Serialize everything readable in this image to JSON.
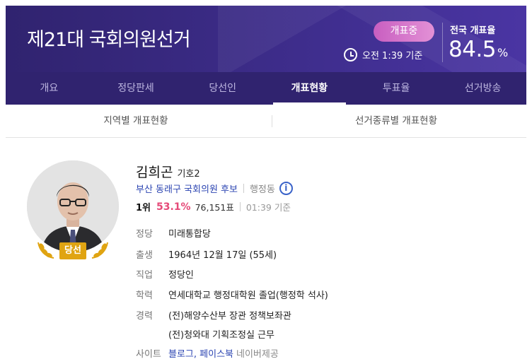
{
  "header": {
    "title": "제21대 국회의원선거",
    "status_badge": "개표중",
    "time_text": "오전 1:39 기준",
    "rate_label": "전국 개표율",
    "rate_value": "84.5",
    "rate_unit": "%"
  },
  "nav": {
    "items": [
      "개요",
      "정당판세",
      "당선인",
      "개표현황",
      "투표율",
      "선거방송"
    ],
    "active": "개표현황"
  },
  "subtabs": [
    "지역별 개표현황",
    "선거종류별 개표현황"
  ],
  "candidate": {
    "name": "김희곤",
    "number": "기호2",
    "district": "부산 동래구 국회의원 후보",
    "dong": "행정동",
    "rank": "1위",
    "percent": "53.1%",
    "votes": "76,151표",
    "time": "01:39 기준",
    "winner_badge": "당선",
    "details": {
      "party_label": "정당",
      "party": "미래통합당",
      "birth_label": "출생",
      "birth": "1964년 12월 17일 (55세)",
      "job_label": "직업",
      "job": "정당인",
      "edu_label": "학력",
      "edu": "연세대학교 행정대학원 졸업(행정학 석사)",
      "career_label": "경력",
      "career": [
        "(전)해양수산부 장관 정책보좌관",
        "(전)청와대 기획조정실 근무"
      ],
      "site_label": "사이트",
      "site_links": "블로그, 페이스북",
      "site_source": "네이버제공"
    }
  },
  "colors": {
    "header_bg": "#30236f",
    "badge_live": "#d270c8",
    "percent": "#e54a78",
    "link": "#2c45b2",
    "winner_badge": "#e0a412"
  }
}
